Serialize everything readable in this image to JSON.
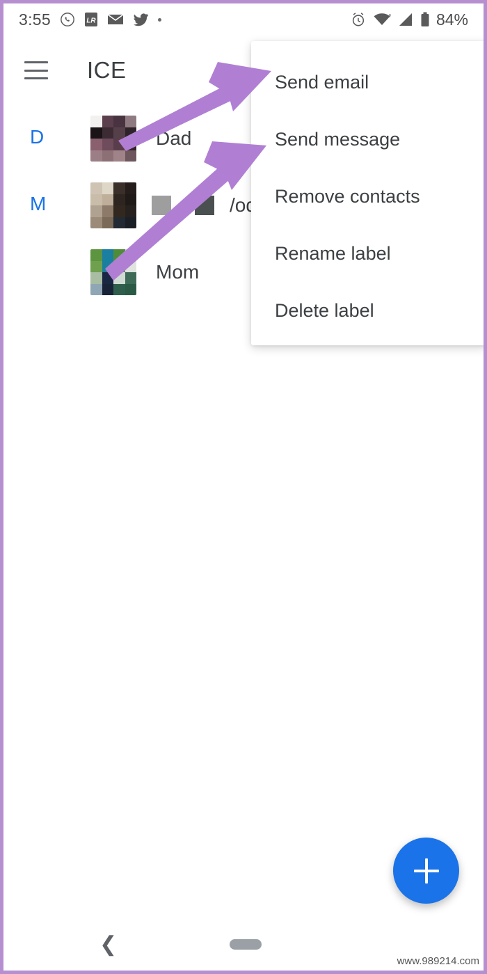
{
  "status_bar": {
    "time": "3:55",
    "battery_percent": "84%",
    "left_icons": [
      "whatsapp-icon",
      "app-badge-icon",
      "mail-icon",
      "twitter-icon",
      "more-dot-icon"
    ],
    "right_icons": [
      "alarm-icon",
      "wifi-icon",
      "cellular-signal-icon",
      "battery-icon"
    ]
  },
  "app_bar": {
    "menu_icon": "hamburger-menu-icon",
    "title": "ICE"
  },
  "contacts": {
    "sections": [
      {
        "letter": "D",
        "rows": [
          {
            "name": "Dad",
            "avatar": "pixelated-photo",
            "redacted": false
          }
        ]
      },
      {
        "letter": "M",
        "rows": [
          {
            "name": "/oda",
            "avatar": "pixelated-photo",
            "redacted": true
          },
          {
            "name": "Mom",
            "avatar": "pixelated-photo",
            "redacted": false
          }
        ]
      }
    ]
  },
  "popup_menu": {
    "items": [
      {
        "label": "Send email"
      },
      {
        "label": "Send message"
      },
      {
        "label": "Remove contacts"
      },
      {
        "label": "Rename label"
      },
      {
        "label": "Delete label"
      }
    ]
  },
  "annotations": {
    "arrow_color": "#b07fd4",
    "arrows": [
      {
        "name": "arrow-to-send-email",
        "points_to": "Send email"
      },
      {
        "name": "arrow-to-send-message",
        "points_to": "Send message"
      }
    ]
  },
  "fab": {
    "icon": "plus-icon",
    "color": "#1a73e8"
  },
  "nav_bar": {
    "back_icon": "back-chevron-icon",
    "home_icon": "home-pill-icon"
  },
  "watermark": {
    "text": "www.989214.com"
  },
  "colors": {
    "accent_blue": "#1a73e8",
    "text_primary": "#3c4043",
    "text_secondary": "#5f6368",
    "frame_purple": "#b58fcf",
    "arrow_purple": "#b07fd4"
  }
}
